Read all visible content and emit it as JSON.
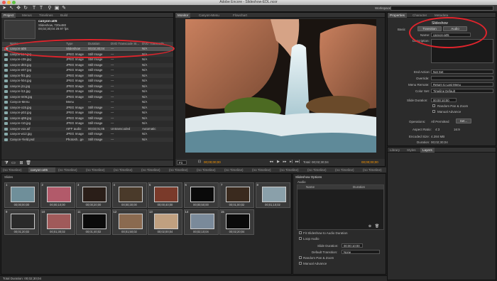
{
  "window": {
    "title": "Adobe Encore - Slideshow-EDL.ncor",
    "workspace_label": "Workspace:",
    "workspace_value": ""
  },
  "project": {
    "tabs": [
      "Project",
      "Menus",
      "Timelines",
      "Build"
    ],
    "preview": {
      "name": "canyon-a05",
      "line1": "Slideshow, 720x480",
      "line2": "00;02;30;04 29.97 fps"
    },
    "columns": [
      "Name",
      "Type",
      "Duration",
      "DVD Transcode St...",
      "DVD Transcode..."
    ],
    "items": [
      {
        "name": "canyon-a05",
        "type": "Slideshow",
        "duration": "00;02;30;04",
        "status": "---",
        "tc": "N/A"
      },
      {
        "name": "canyon-b14.jpg",
        "type": "JPEG Image",
        "duration": "Still Image",
        "status": "---",
        "tc": "N/A"
      },
      {
        "name": "canyon-c09.jpg",
        "type": "JPEG Image",
        "duration": "Still Image",
        "status": "---",
        "tc": "N/A"
      },
      {
        "name": "canyon-d03.jpg",
        "type": "JPEG Image",
        "duration": "Still Image",
        "status": "---",
        "tc": "N/A"
      },
      {
        "name": "canyon-e07.jpg",
        "type": "JPEG Image",
        "duration": "Still Image",
        "status": "---",
        "tc": "N/A"
      },
      {
        "name": "canyon-f01.jpg",
        "type": "JPEG Image",
        "duration": "Still Image",
        "status": "---",
        "tc": "N/A"
      },
      {
        "name": "canyon-h04.jpg",
        "type": "JPEG Image",
        "duration": "Still Image",
        "status": "---",
        "tc": "N/A"
      },
      {
        "name": "canyon-j11.jpg",
        "type": "JPEG Image",
        "duration": "Still Image",
        "status": "---",
        "tc": "N/A"
      },
      {
        "name": "canyon-l13.jpg",
        "type": "JPEG Image",
        "duration": "Still Image",
        "status": "---",
        "tc": "N/A"
      },
      {
        "name": "canyon-m06.jpg",
        "type": "JPEG Image",
        "duration": "Still Image",
        "status": "---",
        "tc": "N/A"
      },
      {
        "name": "Canyon-Menu",
        "type": "Menu",
        "duration": "---",
        "status": "---",
        "tc": "N/A"
      },
      {
        "name": "canyon-o15.jpg",
        "type": "JPEG Image",
        "duration": "Still Image",
        "status": "---",
        "tc": "N/A"
      },
      {
        "name": "canyon-p02.jpg",
        "type": "JPEG Image",
        "duration": "Still Image",
        "status": "---",
        "tc": "N/A"
      },
      {
        "name": "canyon-q08.jpg",
        "type": "JPEG Image",
        "duration": "Still Image",
        "status": "---",
        "tc": "N/A"
      },
      {
        "name": "canyon-r10.jpg",
        "type": "JPEG Image",
        "duration": "Still Image",
        "status": "---",
        "tc": "N/A"
      },
      {
        "name": "canyon-vox.aif",
        "type": "AIFF audio",
        "duration": "00;03;01;05",
        "status": "Untranscoded",
        "tc": "Automatic"
      },
      {
        "name": "canyon-w12.jpg",
        "type": "JPEG Image",
        "duration": "Still Image",
        "status": "---",
        "tc": "N/A"
      },
      {
        "name": "Canyon-Yield.psd",
        "type": "Photosh...ge",
        "duration": "Still Image",
        "status": "---",
        "tc": "N/A"
      }
    ]
  },
  "monitor": {
    "tabs": [
      "Monitor",
      "Canyon-Menu",
      "Flowchart"
    ],
    "timecode_left": "00;00;00;00",
    "total_label": "Total: 00;02;30;04",
    "timecode_right": "00;00;00;00",
    "zoom": "Fit"
  },
  "properties": {
    "tabs": [
      "Properties",
      "Character",
      "Metadata"
    ],
    "header": "Slideshow",
    "subtabs": [
      "Transition",
      "Audio"
    ],
    "basic_label": "Basic",
    "name_label": "Name:",
    "name_value": "canyon-a05",
    "description_label": "Description:",
    "end_action_label": "End Action:",
    "end_action_value": "Not Set",
    "override_label": "Override:",
    "override_value": "",
    "menu_remote_label": "Menu Remote:",
    "menu_remote_value": "Return to Last Menu",
    "color_set_label": "Color Set:",
    "color_set_value": "Timeline Default",
    "slide_duration_label": "Slide Duration:",
    "slide_duration_value": "00;00;10;00",
    "random_pan_label": "Random Pan & Zoom",
    "manual_advance_label": "Manual Advance",
    "operations_label": "Operations:",
    "operations_value": "All Permitted",
    "set_button": "Set...",
    "aspect_label": "Aspect Ratio:",
    "aspect_43": "4:3",
    "aspect_169": "16:9",
    "encoded_label": "Encoded Size:",
    "encoded_value": "4.284 MB",
    "duration_label": "Duration:",
    "duration_value": "00;02;30;04"
  },
  "library": {
    "tabs": [
      "Library",
      "Styles",
      "Layers"
    ]
  },
  "timeline_tabs": [
    "(no Timeline)",
    "canyon-a05",
    "(no Timeline)",
    "(no Timeline)",
    "(no Timeline)",
    "(no Timeline)",
    "(no Timeline)",
    "(no Timeline)",
    "(no Timeline)",
    "(no Timeline)",
    "(no Timeline)",
    "(no Timeline)",
    "(no Timeline)",
    "(no Timeline)"
  ],
  "slides": {
    "label": "Slides",
    "items": [
      {
        "num": "1",
        "tc": "00;00;00;00"
      },
      {
        "num": "2",
        "tc": "00;00;10;00"
      },
      {
        "num": "3",
        "tc": "00;00;20;00"
      },
      {
        "num": "4",
        "tc": "00;00;30;00"
      },
      {
        "num": "5",
        "tc": "00;00;40;00"
      },
      {
        "num": "6",
        "tc": "00;00;50;00"
      },
      {
        "num": "7",
        "tc": "00;01;00;02"
      },
      {
        "num": "8",
        "tc": "00;01;10;02"
      },
      {
        "num": "9",
        "tc": "00;01;20;02"
      },
      {
        "num": "10",
        "tc": "00;01;30;02"
      },
      {
        "num": "11",
        "tc": "00;01;40;02"
      },
      {
        "num": "12",
        "tc": "00;01;50;02"
      },
      {
        "num": "13",
        "tc": "00;02;00;04"
      },
      {
        "num": "14",
        "tc": "00;02;10;04"
      },
      {
        "num": "15",
        "tc": "00;02;20;04"
      }
    ]
  },
  "slideshow_options": {
    "title": "Slideshow Options",
    "audio_label": "Audio",
    "col_name": "Name",
    "col_duration": "Duration",
    "fit_label": "Fit Slideshow to Audio Duration",
    "loop_label": "Loop Audio",
    "slide_duration_label": "Slide Duration:",
    "slide_duration_value": "00;00;10;00",
    "default_transition_label": "Default Transition:",
    "default_transition_value": "None",
    "random_label": "Random Pan & Zoom",
    "manual_label": "Manual Advance"
  },
  "status": {
    "total_duration": "Total Duration: 00;02;30;04"
  },
  "colors": {
    "accent": "#ff9900",
    "highlight": "#e0242c",
    "panel": "#2b2b2b"
  }
}
